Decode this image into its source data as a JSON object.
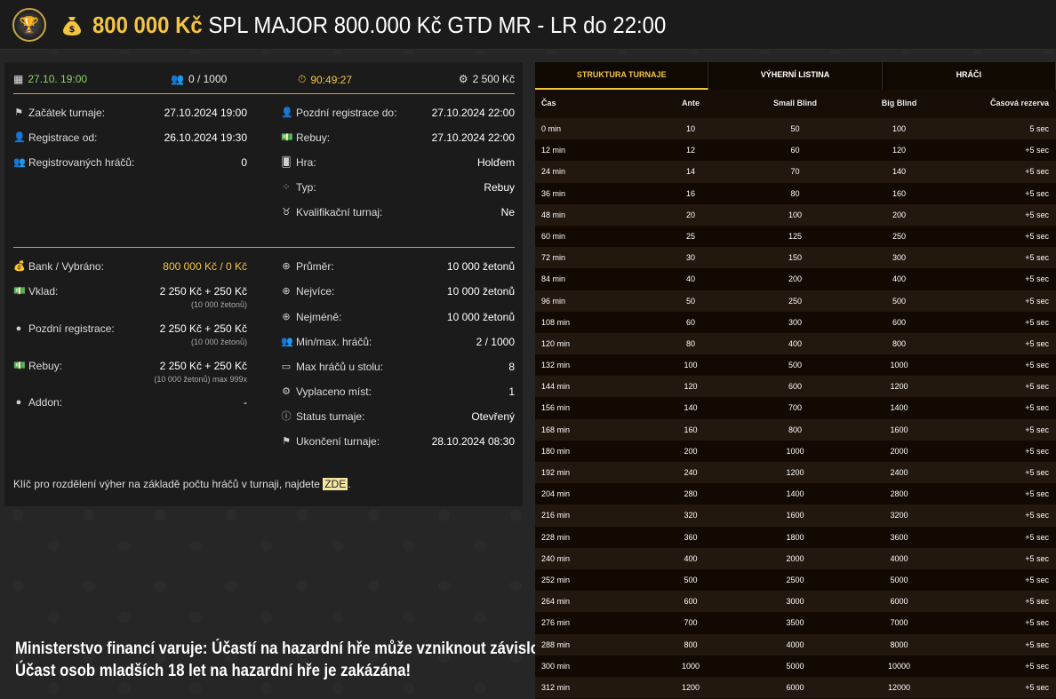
{
  "header": {
    "amount": "800 000 Kč",
    "title": "SPL MAJOR 800.000 Kč GTD MR - LR do 22:00"
  },
  "top_stats": {
    "date": "27.10. 19:00",
    "players": "0 / 1000",
    "timer": "90:49:27",
    "buyin": "2 500 Kč"
  },
  "info_left": [
    {
      "icon": "flag-icon",
      "label": "Začátek turnaje:",
      "value": "27.10.2024 19:00"
    },
    {
      "icon": "user-add-icon",
      "label": "Registrace od:",
      "value": "26.10.2024 19:30"
    },
    {
      "icon": "users-icon",
      "label": "Registrovaných hráčů:",
      "value": "0"
    }
  ],
  "info_right": [
    {
      "icon": "user-add-icon",
      "label": "Pozdní registrace do:",
      "value": "27.10.2024 22:00"
    },
    {
      "icon": "money-icon",
      "label": "Rebuy:",
      "value": "27.10.2024 22:00"
    },
    {
      "icon": "cards-icon",
      "label": "Hra:",
      "value": "Holďem"
    },
    {
      "icon": "chips-icon",
      "label": "Typ:",
      "value": "Rebuy"
    },
    {
      "icon": "medal-icon",
      "label": "Kvalifikační turnaj:",
      "value": "Ne"
    }
  ],
  "money_left": [
    {
      "icon": "moneybag-icon",
      "label": "Bank / Vybráno:",
      "value": "800 000 Kč / 0 Kč",
      "sub": ""
    },
    {
      "icon": "money-icon",
      "label": "Vklad:",
      "value": "2 250 Kč + 250 Kč",
      "sub": "(10 000 žetonů)"
    },
    {
      "icon": "coin-icon",
      "label": "Pozdní registrace:",
      "value": "2 250 Kč + 250 Kč",
      "sub": "(10 000 žetonů)"
    },
    {
      "icon": "money-icon",
      "label": "Rebuy:",
      "value": "2 250 Kč + 250 Kč",
      "sub": "(10 000 žetonů) max 999x"
    },
    {
      "icon": "coin-icon",
      "label": "Addon:",
      "value": "-",
      "sub": ""
    }
  ],
  "money_right": [
    {
      "icon": "plus-circle-icon",
      "label": "Průměr:",
      "value": "10 000 žetonů"
    },
    {
      "icon": "plus-circle-icon",
      "label": "Nejvíce:",
      "value": "10 000 žetonů"
    },
    {
      "icon": "plus-circle-icon",
      "label": "Nejméně:",
      "value": "10 000 žetonů"
    },
    {
      "icon": "users-icon",
      "label": "Min/max. hráčů:",
      "value": "2 / 1000"
    },
    {
      "icon": "table-icon",
      "label": "Max hráčů u stolu:",
      "value": "8"
    },
    {
      "icon": "award-icon",
      "label": "Vyplaceno míst:",
      "value": "1"
    },
    {
      "icon": "info-icon",
      "label": "Status turnaje:",
      "value": "Otevřený"
    },
    {
      "icon": "flag-icon",
      "label": "Ukončení turnaje:",
      "value": "28.10.2024 08:30"
    }
  ],
  "footnote": {
    "text": "Klíč pro rozdělení výher na základě počtu hráčů v turnaji, najdete ",
    "link": "ZDE",
    "end": "."
  },
  "warning": {
    "line1": "Ministerstvo financí varuje: Účastí na hazardní hře může vzniknout závislost!",
    "line2": "Účast osob mladších 18 let na hazardní hře je zakázána!"
  },
  "tabs": [
    "Struktura turnaje",
    "Výherní listina",
    "Hráči"
  ],
  "table": {
    "headers": [
      "Čas",
      "Ante",
      "Small Blind",
      "Big Blind",
      "Časová rezerva"
    ],
    "rows": [
      [
        "0 min",
        "10",
        "50",
        "100",
        "5 sec"
      ],
      [
        "12 min",
        "12",
        "60",
        "120",
        "+5 sec"
      ],
      [
        "24 min",
        "14",
        "70",
        "140",
        "+5 sec"
      ],
      [
        "36 min",
        "16",
        "80",
        "160",
        "+5 sec"
      ],
      [
        "48 min",
        "20",
        "100",
        "200",
        "+5 sec"
      ],
      [
        "60 min",
        "25",
        "125",
        "250",
        "+5 sec"
      ],
      [
        "72 min",
        "30",
        "150",
        "300",
        "+5 sec"
      ],
      [
        "84 min",
        "40",
        "200",
        "400",
        "+5 sec"
      ],
      [
        "96 min",
        "50",
        "250",
        "500",
        "+5 sec"
      ],
      [
        "108 min",
        "60",
        "300",
        "600",
        "+5 sec"
      ],
      [
        "120 min",
        "80",
        "400",
        "800",
        "+5 sec"
      ],
      [
        "132 min",
        "100",
        "500",
        "1000",
        "+5 sec"
      ],
      [
        "144 min",
        "120",
        "600",
        "1200",
        "+5 sec"
      ],
      [
        "156 min",
        "140",
        "700",
        "1400",
        "+5 sec"
      ],
      [
        "168 min",
        "160",
        "800",
        "1600",
        "+5 sec"
      ],
      [
        "180 min",
        "200",
        "1000",
        "2000",
        "+5 sec"
      ],
      [
        "192 min",
        "240",
        "1200",
        "2400",
        "+5 sec"
      ],
      [
        "204 min",
        "280",
        "1400",
        "2800",
        "+5 sec"
      ],
      [
        "216 min",
        "320",
        "1600",
        "3200",
        "+5 sec"
      ],
      [
        "228 min",
        "360",
        "1800",
        "3600",
        "+5 sec"
      ],
      [
        "240 min",
        "400",
        "2000",
        "4000",
        "+5 sec"
      ],
      [
        "252 min",
        "500",
        "2500",
        "5000",
        "+5 sec"
      ],
      [
        "264 min",
        "600",
        "3000",
        "6000",
        "+5 sec"
      ],
      [
        "276 min",
        "700",
        "3500",
        "7000",
        "+5 sec"
      ],
      [
        "288 min",
        "800",
        "4000",
        "8000",
        "+5 sec"
      ],
      [
        "300 min",
        "1000",
        "5000",
        "10000",
        "+5 sec"
      ],
      [
        "312 min",
        "1200",
        "6000",
        "12000",
        "+5 sec"
      ]
    ]
  }
}
